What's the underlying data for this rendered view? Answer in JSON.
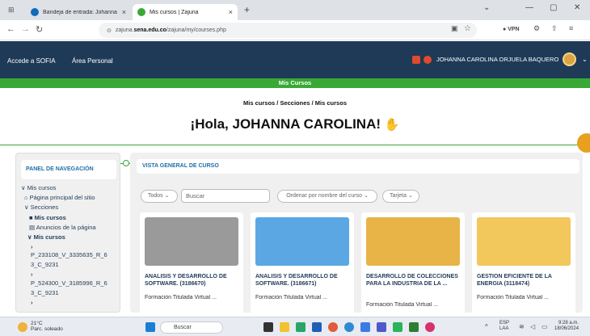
{
  "browser": {
    "tabs": [
      {
        "title": "Bandeja de entrada: Johanna C",
        "icon": "outlook-icon",
        "color": "#0f6cbd"
      },
      {
        "title": "Mis cursos | Zajuna",
        "icon": "zajuna-icon",
        "color": "#39a935"
      }
    ],
    "new_tab": "+",
    "url_prefix": "zajuna.",
    "url_domain": "sena.edu.co",
    "url_path": "/zajuna/my/courses.php",
    "vpn_label": "VPN"
  },
  "header": {
    "link1": "Accede a SOFIA",
    "link2": "Área Personal",
    "user_name": "JOHANNA CAROLINA ORJUELA BAQUERO"
  },
  "page": {
    "green_bar": "Mis Cursos",
    "breadcrumb": "Mis cursos / Secciones / Mis cursos",
    "greeting": "¡Hola, JOHANNA CAROLINA!"
  },
  "sidebar": {
    "title": "PANEL DE NAVEGACIÓN",
    "items": [
      {
        "label": "Mis cursos"
      },
      {
        "label": "Página principal del sitio"
      },
      {
        "label": "Secciones"
      },
      {
        "label": "Mis cursos"
      },
      {
        "label": "Anuncios de la página"
      },
      {
        "label": "Mis cursos"
      },
      {
        "label": "P_233108_V_3335635_R_6"
      },
      {
        "label": "3_C_9231"
      },
      {
        "label": "P_524300_V_3185996_R_6"
      },
      {
        "label": "3_C_9231"
      }
    ]
  },
  "main": {
    "title": "VISTA GENERAL DE CURSO",
    "filter_all": "Todos",
    "search_placeholder": "Buscar",
    "sort_label": "Ordenar por nombre del curso",
    "view_label": "Tarjeta",
    "courses": [
      {
        "title": "ANALISIS Y DESARROLLO DE SOFTWARE. (3186670)",
        "subtitle": "Formación Titulada Virtual ...",
        "color": "#9a9a9a"
      },
      {
        "title": "ANALISIS Y DESARROLLO DE SOFTWARE. (3186671)",
        "subtitle": "Formación Titulada Virtual ...",
        "color": "#5aa7e3"
      },
      {
        "title": "DESARROLLO DE COLECCIONES PARA LA INDUSTRIA DE LA ...",
        "subtitle": "Formación Titulada Virtual ...",
        "color": "#e8b447"
      },
      {
        "title": "GESTION EFICIENTE DE LA ENERGIA (3118474)",
        "subtitle": "Formación Titulada Virtual ...",
        "color": "#f2c75c"
      }
    ]
  },
  "taskbar": {
    "temp": "21°C",
    "weather": "Parc. soleado",
    "search": "Buscar",
    "lang1": "ESP",
    "lang2": "LAA",
    "time": "9:28 a.m.",
    "date": "18/06/2024"
  },
  "colors": {
    "header": "#1e3a57",
    "green": "#39a935",
    "link": "#1e6fa8"
  }
}
